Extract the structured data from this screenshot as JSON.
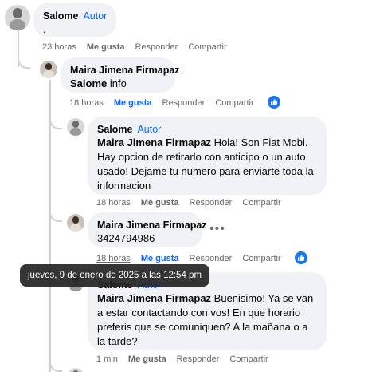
{
  "comments": [
    {
      "author": "Salome",
      "badge": "Autor",
      "text": ".",
      "time": "23 horas",
      "like": "Me gusta",
      "reply": "Responder",
      "share": "Compartir"
    },
    {
      "author": "Maira Jimena Firmapaz",
      "mention": "Salome",
      "text": " info",
      "time": "18 horas",
      "like": "Me gusta",
      "reply": "Responder",
      "share": "Compartir"
    },
    {
      "author": "Salome",
      "badge": "Autor",
      "mention": "Maira Jimena Firmapaz",
      "text": " Hola! Son Fiat Mobi. Hay opcion de retirarlo con anticipo o un auto usado! Dejame tu numero para enviarte toda la informacion",
      "time": "18 horas",
      "like": "Me gusta",
      "reply": "Responder",
      "share": "Compartir"
    },
    {
      "author": "Maira Jimena Firmapaz",
      "text": "3424794986",
      "time": "18 horas",
      "like": "Me gusta",
      "reply": "Responder",
      "share": "Compartir"
    },
    {
      "author": "Salome",
      "badge": "Autor",
      "mention": "Maira Jimena Firmapaz",
      "text": " Buenisimo! Ya se van a estar contactando con vos! En que horario preferis que se comuniquen? A la mañana o a la tarde?",
      "time": "1 min",
      "like": "Me gusta",
      "reply": "Responder",
      "share": "Compartir"
    }
  ],
  "tooltip": "jueves, 9 de enero de 2025 a las 12:54 pm",
  "colors": {
    "accent": "#0866ff",
    "bubble": "#f0f2f5",
    "muted": "#65676b"
  },
  "icons": {
    "like": "thumbs-up-icon",
    "more": "more-options-icon"
  }
}
